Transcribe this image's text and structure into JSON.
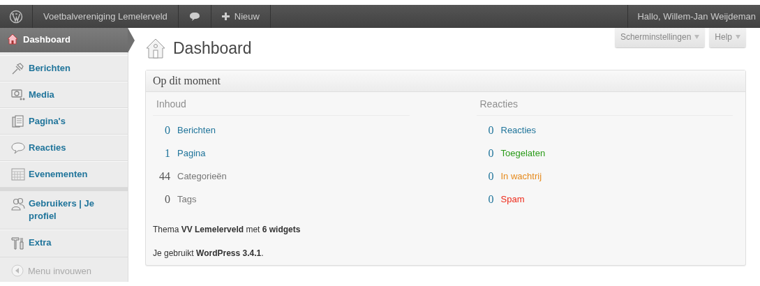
{
  "admin_bar": {
    "site_name": "Voetbalvereniging Lemelerveld",
    "new_label": "Nieuw",
    "greeting": "Hallo, Willem-Jan Weijdeman"
  },
  "sidebar": {
    "items": [
      {
        "label": "Dashboard",
        "kind": "dashboard",
        "selected": true
      },
      {
        "label": "Berichten",
        "kind": "pin",
        "selected": false
      },
      {
        "label": "Media",
        "kind": "media",
        "selected": false
      },
      {
        "label": "Pagina's",
        "kind": "pages",
        "selected": false
      },
      {
        "label": "Reacties",
        "kind": "comments",
        "selected": false
      },
      {
        "label": "Evenementen",
        "kind": "calendar",
        "selected": false
      },
      {
        "label": "Gebruikers | Je profiel",
        "kind": "users",
        "selected": false
      },
      {
        "label": "Extra",
        "kind": "tools",
        "selected": false
      }
    ],
    "collapse_label": "Menu invouwen"
  },
  "screen_buttons": [
    "Scherminstellingen",
    "Help"
  ],
  "page_title": "Dashboard",
  "widget": {
    "title": "Op dit moment",
    "content": {
      "heading": "Inhoud",
      "rows": [
        {
          "count": "0",
          "label": "Berichten",
          "kind": "link"
        },
        {
          "count": "1",
          "label": "Pagina",
          "kind": "link"
        },
        {
          "count": "44",
          "label": "Categorieën",
          "kind": "plain"
        },
        {
          "count": "0",
          "label": "Tags",
          "kind": "plain"
        }
      ]
    },
    "discussion": {
      "heading": "Reacties",
      "rows": [
        {
          "count": "0",
          "label": "Reacties",
          "color": "#21759b"
        },
        {
          "count": "0",
          "label": "Toegelaten",
          "color": "#2a9b19"
        },
        {
          "count": "0",
          "label": "In wachtrij",
          "color": "#e68a1c"
        },
        {
          "count": "0",
          "label": "Spam",
          "color": "#ee2a1a"
        }
      ]
    },
    "theme_line": "Thema **VV Lemelerveld** met **6 widgets**",
    "version_line": "Je gebruikt **WordPress 3.4.1**."
  }
}
